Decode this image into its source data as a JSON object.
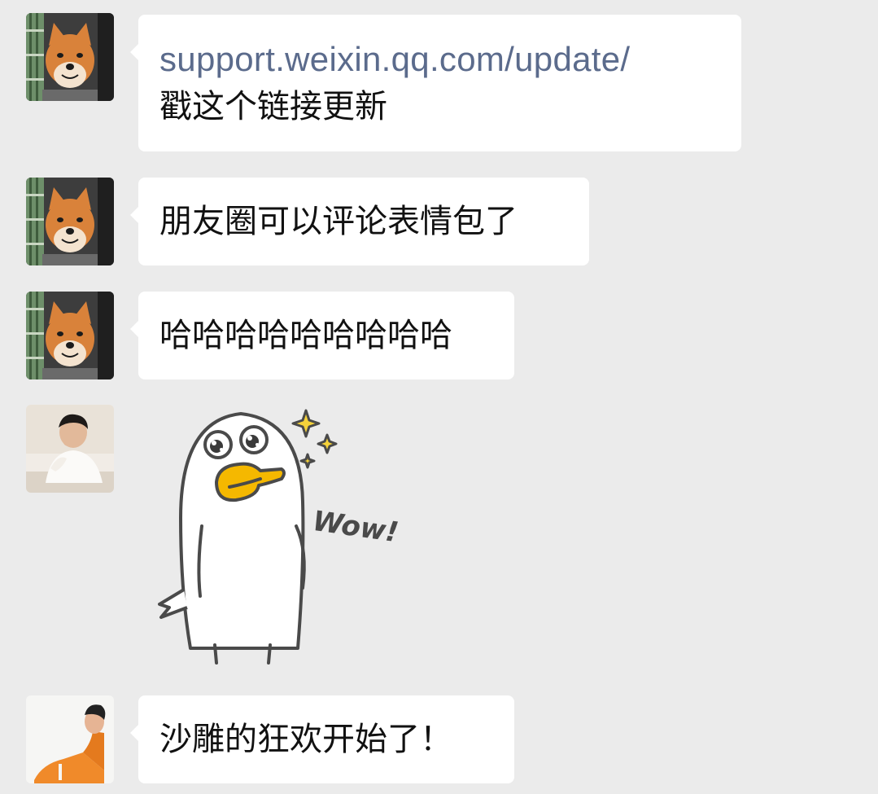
{
  "chat": {
    "messages": [
      {
        "avatar": "shiba-dog-avatar",
        "link": "support.weixin.qq.com/update/",
        "text": "戳这个链接更新"
      },
      {
        "avatar": "shiba-dog-avatar",
        "text": "朋友圈可以评论表情包了"
      },
      {
        "avatar": "shiba-dog-avatar",
        "text": "哈哈哈哈哈哈哈哈哈"
      },
      {
        "avatar": "man-sweater-avatar",
        "sticker": {
          "name": "duck-wow-sticker",
          "caption": "Wow!"
        }
      },
      {
        "avatar": "man-orange-avatar",
        "text": "沙雕的狂欢开始了！"
      }
    ]
  },
  "colors": {
    "background": "#ebebeb",
    "bubble": "#ffffff",
    "link": "#5b6b8c",
    "duck_beak": "#f5b800"
  }
}
